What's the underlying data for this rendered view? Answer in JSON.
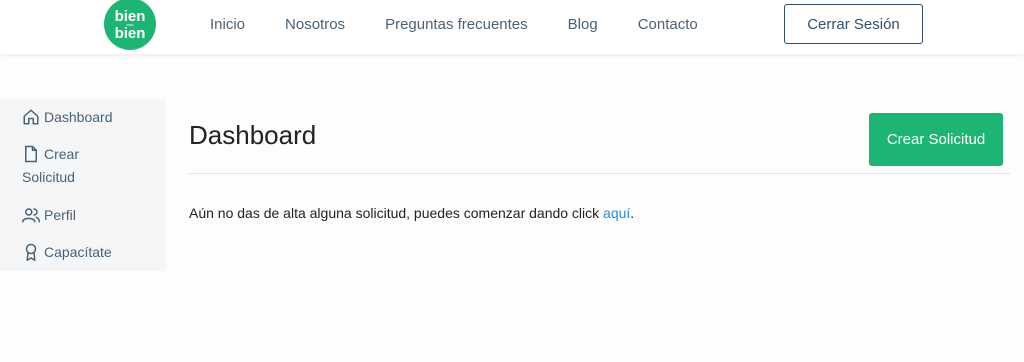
{
  "brand": {
    "logo_top": "bien",
    "logo_mid": "con",
    "logo_bottom": "bien",
    "color": "#1db573"
  },
  "nav": {
    "items": [
      "Inicio",
      "Nosotros",
      "Preguntas frecuentes",
      "Blog",
      "Contacto"
    ],
    "logout_label": "Cerrar Sesión"
  },
  "sidebar": {
    "items": [
      {
        "label": "Dashboard",
        "icon": "home-icon"
      },
      {
        "label": "Crear",
        "label2": "Solicitud",
        "icon": "file-icon"
      },
      {
        "label": "Perfil",
        "icon": "users-icon"
      },
      {
        "label": "Capacítate",
        "icon": "award-icon"
      }
    ]
  },
  "main": {
    "title": "Dashboard",
    "create_label": "Crear Solicitud",
    "message_text": "Aún no das de alta alguna solicitud, puedes comenzar dando click ",
    "message_link": "aquí",
    "message_end": "."
  }
}
